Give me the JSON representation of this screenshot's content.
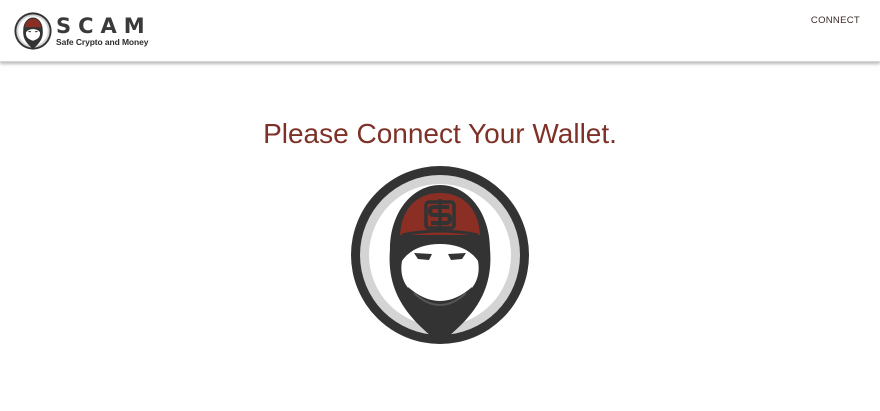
{
  "header": {
    "brand_name": "SCAM",
    "brand_tagline": "Safe Crypto and Money",
    "connect_label": "CONNECT"
  },
  "main": {
    "heading": "Please Connect Your Wallet."
  },
  "icons": {
    "brand_logo": "hooded-figure-logo",
    "hero_logo": "hooded-figure-logo",
    "cap_symbol": "dollar-sign-icon"
  },
  "colors": {
    "accent": "#7d3127",
    "cap": "#8b2f24",
    "dark": "#333333",
    "ring_light": "#cfcfcf"
  }
}
